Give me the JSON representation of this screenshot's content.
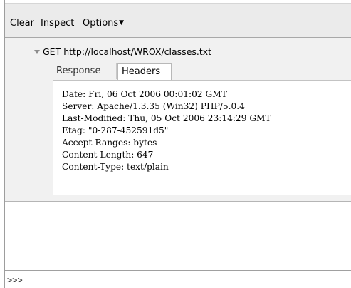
{
  "toolbar": {
    "clear_label": "Clear",
    "inspect_label": "Inspect",
    "options_label": "Options",
    "options_caret": "▼"
  },
  "request": {
    "method_url": "GET http://localhost/WROX/classes.txt"
  },
  "tabs": [
    {
      "label": "Response",
      "selected": false
    },
    {
      "label": "Headers",
      "selected": true
    }
  ],
  "headers": [
    "Date: Fri, 06 Oct 2006 00:01:02 GMT",
    "Server: Apache/1.3.35 (Win32) PHP/5.0.4",
    "Last-Modified: Thu, 05 Oct 2006 23:14:29 GMT",
    "Etag: \"0-287-452591d5\"",
    "Accept-Ranges: bytes",
    "Content-Length: 647",
    "Content-Type: text/plain"
  ],
  "command_line": {
    "prompt": ">>>",
    "value": ""
  }
}
